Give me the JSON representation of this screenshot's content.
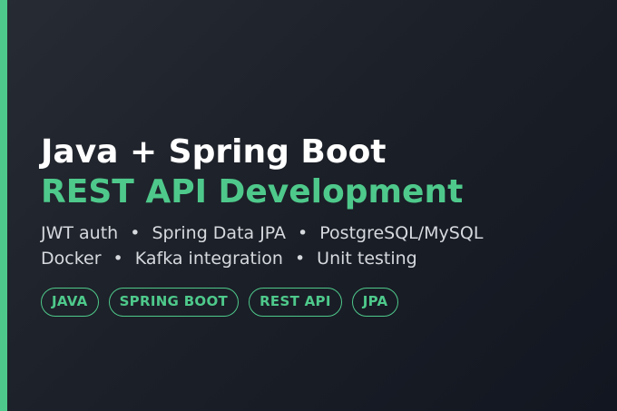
{
  "banner": {
    "accent_color": "#4ec98b",
    "background_colors": [
      "#272b33",
      "#121620"
    ],
    "title": "Java + Spring Boot",
    "subtitle": "REST API Development",
    "separator": "•",
    "features_line1": [
      "JWT auth",
      "Spring Data JPA",
      "PostgreSQL/MySQL"
    ],
    "features_line2": [
      "Docker",
      "Kafka integration",
      "Unit testing"
    ],
    "tags": [
      "JAVA",
      "SPRING BOOT",
      "REST API",
      "JPA"
    ]
  }
}
